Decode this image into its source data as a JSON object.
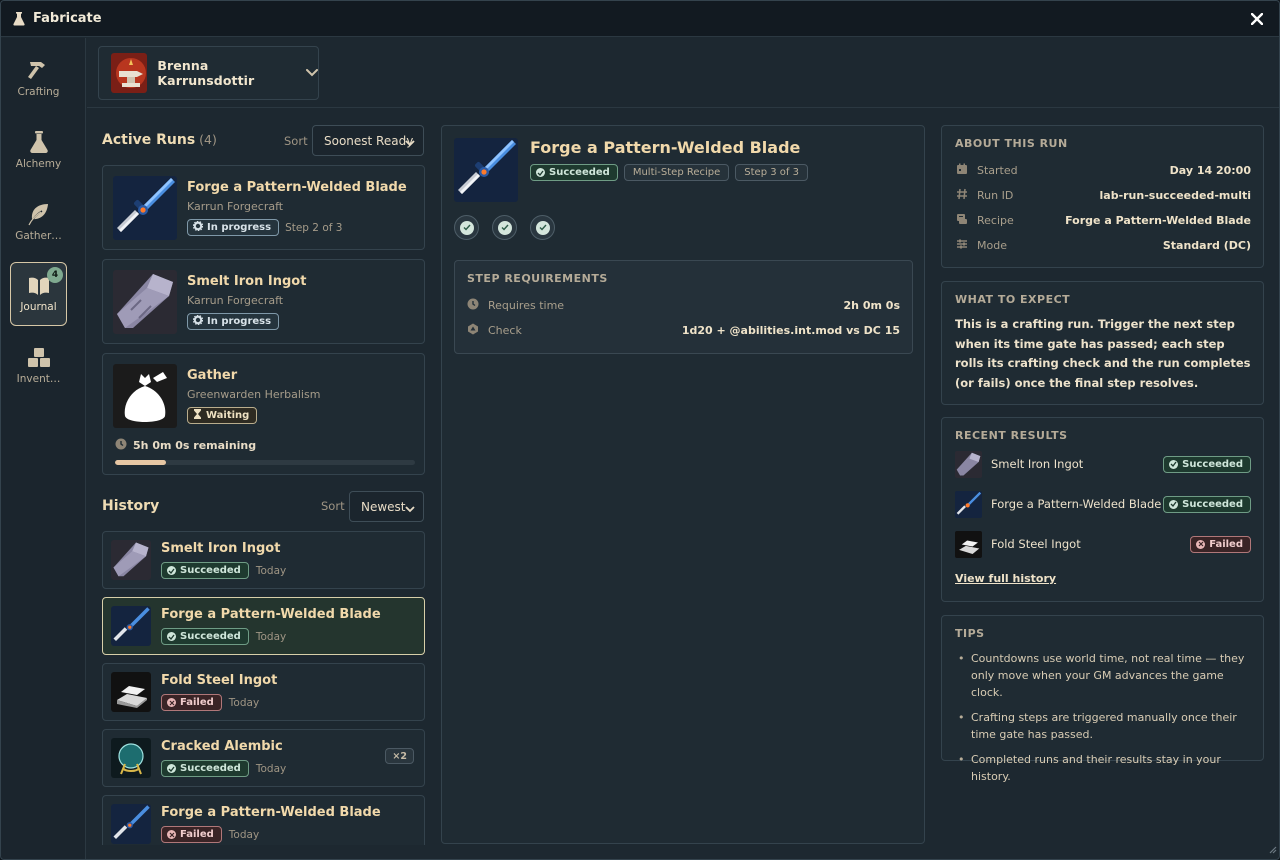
{
  "app": {
    "title": "Fabricate",
    "close_label": "×"
  },
  "nav": [
    {
      "label": "Crafting",
      "icon": "hammer-icon"
    },
    {
      "label": "Alchemy",
      "icon": "flask-icon"
    },
    {
      "label": "Gather…",
      "icon": "leaf-icon"
    },
    {
      "label": "Journal",
      "icon": "book-icon",
      "badge": "4",
      "active": true
    },
    {
      "label": "Invent…",
      "icon": "boxes-icon"
    }
  ],
  "actor": {
    "name": "Brenna Karrunsdottir"
  },
  "active_runs": {
    "title": "Active Runs",
    "count": "(4)",
    "sort_label": "Sort",
    "sort_value": "Soonest Ready",
    "items": [
      {
        "title": "Forge a Pattern-Welded Blade",
        "subtitle": "Karrun Forgecraft",
        "status": "In progress",
        "step": "Step 2 of 3"
      },
      {
        "title": "Smelt Iron Ingot",
        "subtitle": "Karrun Forgecraft",
        "status": "In progress",
        "step": ""
      },
      {
        "title": "Gather",
        "subtitle": "Greenwarden Herbalism",
        "status": "Waiting",
        "remaining": "5h 0m 0s remaining",
        "progress": 0.17
      }
    ]
  },
  "history": {
    "title": "History",
    "sort_label": "Sort",
    "sort_value": "Newest",
    "items": [
      {
        "title": "Smelt Iron Ingot",
        "status": "Succeeded",
        "when": "Today"
      },
      {
        "title": "Forge a Pattern-Welded Blade",
        "status": "Succeeded",
        "when": "Today",
        "selected": true
      },
      {
        "title": "Fold Steel Ingot",
        "status": "Failed",
        "when": "Today"
      },
      {
        "title": "Cracked Alembic",
        "status": "Succeeded",
        "when": "Today",
        "qty": "×2"
      },
      {
        "title": "Forge a Pattern-Welded Blade",
        "status": "Failed",
        "when": "Today"
      }
    ]
  },
  "detail": {
    "title": "Forge a Pattern-Welded Blade",
    "status": "Succeeded",
    "tags": [
      "Multi-Step Recipe",
      "Step 3 of 3"
    ],
    "requirements": {
      "title": "STEP REQUIREMENTS",
      "rows": [
        {
          "label": "Requires time",
          "value": "2h 0m 0s"
        },
        {
          "label": "Check",
          "value": "1d20 + @abilities.int.mod vs DC 15"
        }
      ]
    }
  },
  "about": {
    "title": "ABOUT THIS RUN",
    "rows": [
      {
        "label": "Started",
        "value": "Day 14 20:00"
      },
      {
        "label": "Run ID",
        "value": "lab-run-succeeded-multi"
      },
      {
        "label": "Recipe",
        "value": "Forge a Pattern-Welded Blade"
      },
      {
        "label": "Mode",
        "value": "Standard (DC)"
      }
    ]
  },
  "expect": {
    "title": "WHAT TO EXPECT",
    "text": "This is a crafting run. Trigger the next step when its time gate has passed; each step rolls its crafting check and the run completes (or fails) once the final step resolves."
  },
  "recent": {
    "title": "RECENT RESULTS",
    "items": [
      {
        "name": "Smelt Iron Ingot",
        "status": "Succeeded"
      },
      {
        "name": "Forge a Pattern-Welded Blade",
        "status": "Succeeded"
      },
      {
        "name": "Fold Steel Ingot",
        "status": "Failed"
      }
    ],
    "link": "View full history"
  },
  "tips": {
    "title": "TIPS",
    "items": [
      "Countdowns use world time, not real time — they only move when your GM advances the game clock.",
      "Crafting steps are triggered manually once their time gate has passed.",
      "Completed runs and their results stay in your history."
    ]
  },
  "colors": {
    "accent": "#f1d9ab",
    "success": "#6f9c85",
    "fail": "#b07779",
    "bg": "#1d2830"
  }
}
